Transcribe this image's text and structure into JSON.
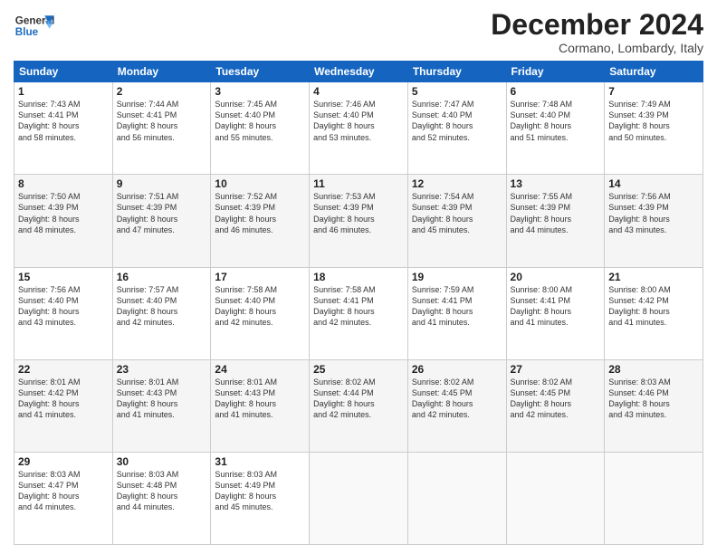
{
  "header": {
    "logo_line1": "General",
    "logo_line2": "Blue",
    "month": "December 2024",
    "location": "Cormano, Lombardy, Italy"
  },
  "weekdays": [
    "Sunday",
    "Monday",
    "Tuesday",
    "Wednesday",
    "Thursday",
    "Friday",
    "Saturday"
  ],
  "weeks": [
    [
      {
        "day": "1",
        "info": "Sunrise: 7:43 AM\nSunset: 4:41 PM\nDaylight: 8 hours\nand 58 minutes."
      },
      {
        "day": "2",
        "info": "Sunrise: 7:44 AM\nSunset: 4:41 PM\nDaylight: 8 hours\nand 56 minutes."
      },
      {
        "day": "3",
        "info": "Sunrise: 7:45 AM\nSunset: 4:40 PM\nDaylight: 8 hours\nand 55 minutes."
      },
      {
        "day": "4",
        "info": "Sunrise: 7:46 AM\nSunset: 4:40 PM\nDaylight: 8 hours\nand 53 minutes."
      },
      {
        "day": "5",
        "info": "Sunrise: 7:47 AM\nSunset: 4:40 PM\nDaylight: 8 hours\nand 52 minutes."
      },
      {
        "day": "6",
        "info": "Sunrise: 7:48 AM\nSunset: 4:40 PM\nDaylight: 8 hours\nand 51 minutes."
      },
      {
        "day": "7",
        "info": "Sunrise: 7:49 AM\nSunset: 4:39 PM\nDaylight: 8 hours\nand 50 minutes."
      }
    ],
    [
      {
        "day": "8",
        "info": "Sunrise: 7:50 AM\nSunset: 4:39 PM\nDaylight: 8 hours\nand 48 minutes."
      },
      {
        "day": "9",
        "info": "Sunrise: 7:51 AM\nSunset: 4:39 PM\nDaylight: 8 hours\nand 47 minutes."
      },
      {
        "day": "10",
        "info": "Sunrise: 7:52 AM\nSunset: 4:39 PM\nDaylight: 8 hours\nand 46 minutes."
      },
      {
        "day": "11",
        "info": "Sunrise: 7:53 AM\nSunset: 4:39 PM\nDaylight: 8 hours\nand 46 minutes."
      },
      {
        "day": "12",
        "info": "Sunrise: 7:54 AM\nSunset: 4:39 PM\nDaylight: 8 hours\nand 45 minutes."
      },
      {
        "day": "13",
        "info": "Sunrise: 7:55 AM\nSunset: 4:39 PM\nDaylight: 8 hours\nand 44 minutes."
      },
      {
        "day": "14",
        "info": "Sunrise: 7:56 AM\nSunset: 4:39 PM\nDaylight: 8 hours\nand 43 minutes."
      }
    ],
    [
      {
        "day": "15",
        "info": "Sunrise: 7:56 AM\nSunset: 4:40 PM\nDaylight: 8 hours\nand 43 minutes."
      },
      {
        "day": "16",
        "info": "Sunrise: 7:57 AM\nSunset: 4:40 PM\nDaylight: 8 hours\nand 42 minutes."
      },
      {
        "day": "17",
        "info": "Sunrise: 7:58 AM\nSunset: 4:40 PM\nDaylight: 8 hours\nand 42 minutes."
      },
      {
        "day": "18",
        "info": "Sunrise: 7:58 AM\nSunset: 4:41 PM\nDaylight: 8 hours\nand 42 minutes."
      },
      {
        "day": "19",
        "info": "Sunrise: 7:59 AM\nSunset: 4:41 PM\nDaylight: 8 hours\nand 41 minutes."
      },
      {
        "day": "20",
        "info": "Sunrise: 8:00 AM\nSunset: 4:41 PM\nDaylight: 8 hours\nand 41 minutes."
      },
      {
        "day": "21",
        "info": "Sunrise: 8:00 AM\nSunset: 4:42 PM\nDaylight: 8 hours\nand 41 minutes."
      }
    ],
    [
      {
        "day": "22",
        "info": "Sunrise: 8:01 AM\nSunset: 4:42 PM\nDaylight: 8 hours\nand 41 minutes."
      },
      {
        "day": "23",
        "info": "Sunrise: 8:01 AM\nSunset: 4:43 PM\nDaylight: 8 hours\nand 41 minutes."
      },
      {
        "day": "24",
        "info": "Sunrise: 8:01 AM\nSunset: 4:43 PM\nDaylight: 8 hours\nand 41 minutes."
      },
      {
        "day": "25",
        "info": "Sunrise: 8:02 AM\nSunset: 4:44 PM\nDaylight: 8 hours\nand 42 minutes."
      },
      {
        "day": "26",
        "info": "Sunrise: 8:02 AM\nSunset: 4:45 PM\nDaylight: 8 hours\nand 42 minutes."
      },
      {
        "day": "27",
        "info": "Sunrise: 8:02 AM\nSunset: 4:45 PM\nDaylight: 8 hours\nand 42 minutes."
      },
      {
        "day": "28",
        "info": "Sunrise: 8:03 AM\nSunset: 4:46 PM\nDaylight: 8 hours\nand 43 minutes."
      }
    ],
    [
      {
        "day": "29",
        "info": "Sunrise: 8:03 AM\nSunset: 4:47 PM\nDaylight: 8 hours\nand 44 minutes."
      },
      {
        "day": "30",
        "info": "Sunrise: 8:03 AM\nSunset: 4:48 PM\nDaylight: 8 hours\nand 44 minutes."
      },
      {
        "day": "31",
        "info": "Sunrise: 8:03 AM\nSunset: 4:49 PM\nDaylight: 8 hours\nand 45 minutes."
      },
      null,
      null,
      null,
      null
    ]
  ]
}
